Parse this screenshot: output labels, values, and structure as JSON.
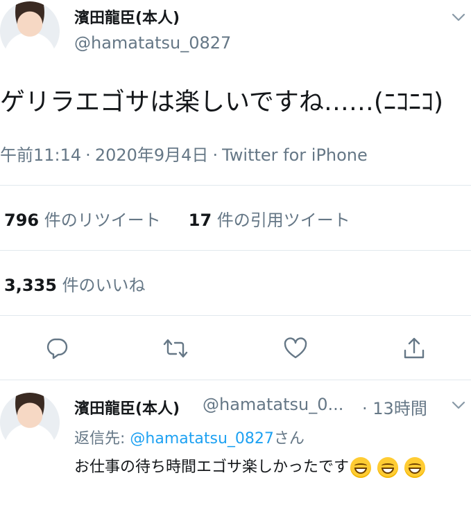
{
  "tweet": {
    "author_name": "濱田龍臣(本人)",
    "author_handle": "@hamatatsu_0827",
    "text": "ゲリラエゴサは楽しいですね……(ﾆｺﾆｺ)",
    "time": "午前11:14",
    "date": "2020年9月4日",
    "source": "Twitter for iPhone",
    "separator": "·"
  },
  "stats": {
    "retweet_count": "796",
    "retweet_label": "件のリツイート",
    "quote_count": "17",
    "quote_label": "件の引用ツイート",
    "like_count": "3,335",
    "like_label": "件のいいね"
  },
  "actions": {
    "reply_icon": "reply-icon",
    "retweet_icon": "retweet-icon",
    "like_icon": "heart-icon",
    "share_icon": "share-icon"
  },
  "reply": {
    "author_name": "濱田龍臣(本人)",
    "author_handle": "@hamatatsu_0...",
    "separator": "·",
    "time": "13時間",
    "reply_to_label": "返信先:",
    "reply_to_handle": "@hamatatsu_0827",
    "reply_to_suffix": "さん",
    "text": "お仕事の待ち時間エゴサ楽しかったです"
  },
  "colors": {
    "text": "#14171a",
    "secondary": "#657786",
    "link": "#1da1f2",
    "divider": "#e1e8ed"
  }
}
